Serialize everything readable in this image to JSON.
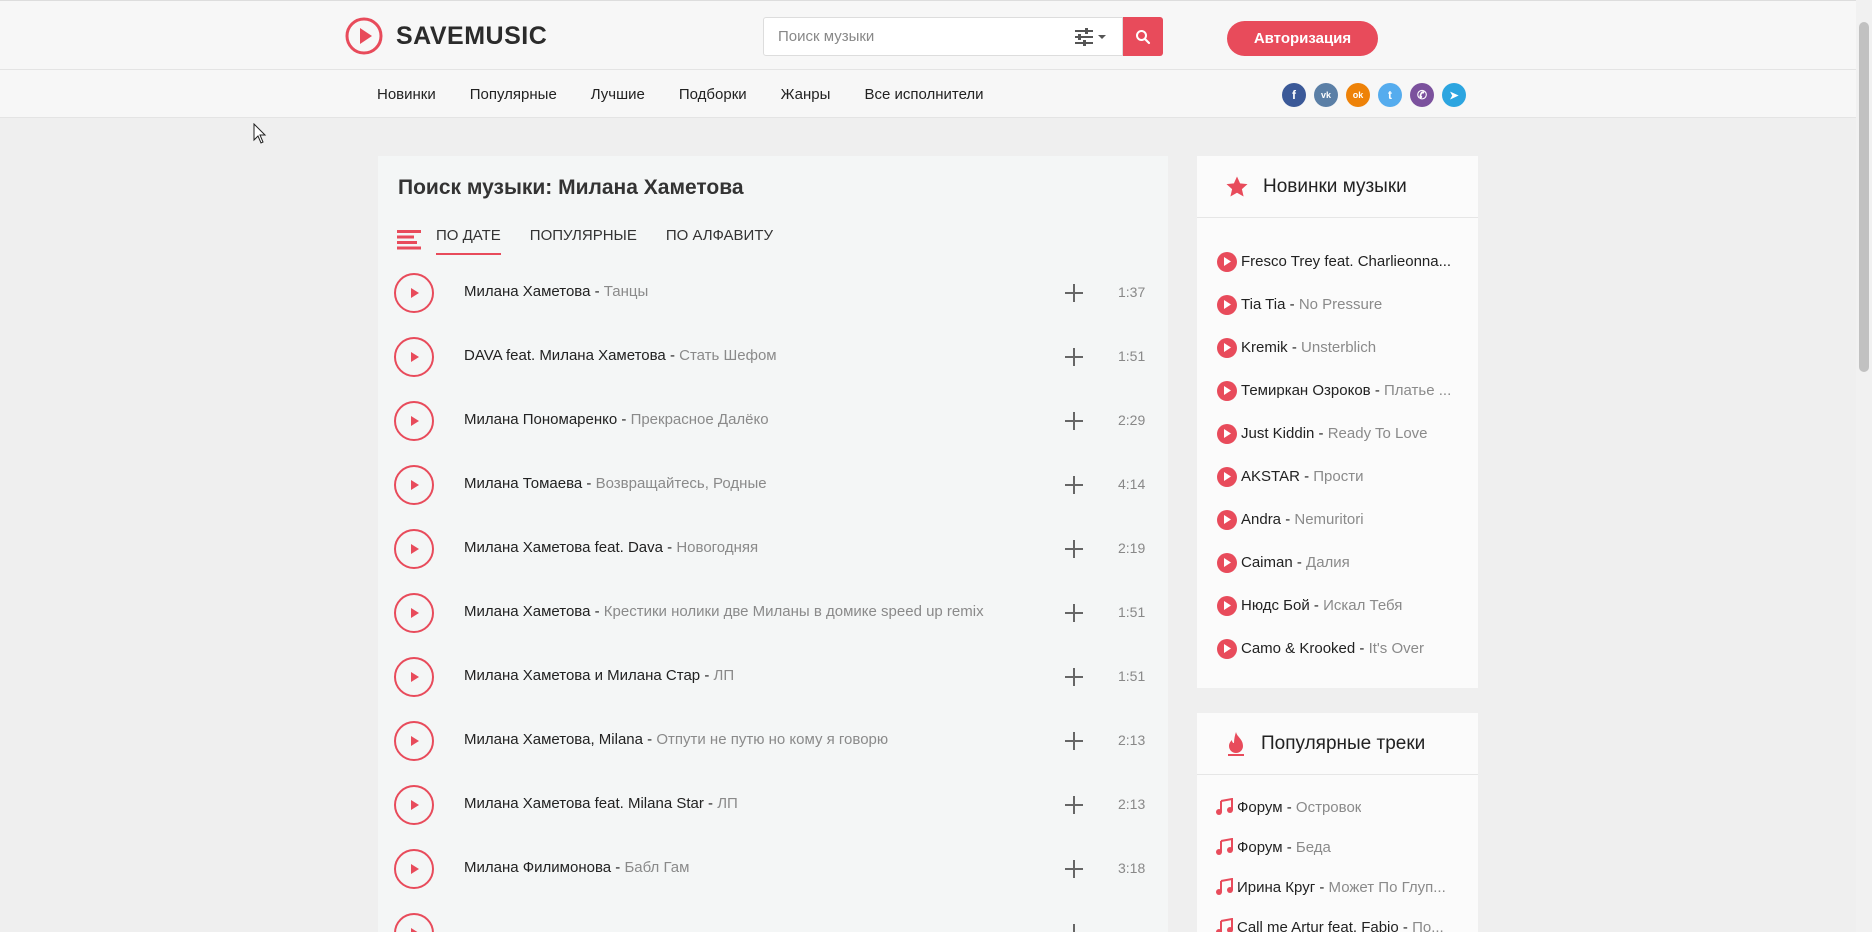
{
  "header": {
    "logo_text": "SAVEMUSIC",
    "search_placeholder": "Поиск музыки",
    "auth_label": "Авторизация",
    "accent_color": "#e84b5b"
  },
  "nav": {
    "items": [
      "Новинки",
      "Популярные",
      "Лучшие",
      "Подборки",
      "Жанры",
      "Все исполнители"
    ]
  },
  "socials": [
    {
      "name": "facebook",
      "glyph": "f",
      "color": "#3b5998"
    },
    {
      "name": "vk",
      "glyph": "vk",
      "color": "#5b7fa6"
    },
    {
      "name": "odnoklassniki",
      "glyph": "ok",
      "color": "#ee8208"
    },
    {
      "name": "twitter",
      "glyph": "t",
      "color": "#55acee"
    },
    {
      "name": "viber",
      "glyph": "✆",
      "color": "#7b519d"
    },
    {
      "name": "telegram",
      "glyph": "➤",
      "color": "#2ca5e0"
    }
  ],
  "main": {
    "title": "Поиск музыки: Милана Хаметова",
    "tabs": [
      "ПО ДАТЕ",
      "ПОПУЛЯРНЫЕ",
      "ПО АЛФАВИТУ"
    ],
    "active_tab": 0,
    "tracks": [
      {
        "artist": "Милана Хаметова",
        "song": "Танцы",
        "duration": "1:37"
      },
      {
        "artist": "DAVA feat. Милана Хаметова",
        "song": "Стать Шефом",
        "duration": "1:51"
      },
      {
        "artist": "Милана Пономаренко",
        "song": "Прекрасное Далёко",
        "duration": "2:29"
      },
      {
        "artist": "Милана Томаева",
        "song": "Возвращайтесь, Родные",
        "duration": "4:14"
      },
      {
        "artist": "Милана Хаметова feat. Dava",
        "song": "Новогодняя",
        "duration": "2:19"
      },
      {
        "artist": "Милана Хаметова",
        "song": "Крестики нолики две Миланы в домике speed up remix",
        "duration": "1:51"
      },
      {
        "artist": "Милана Хаметова и Милана Стар",
        "song": "ЛП",
        "duration": "1:51"
      },
      {
        "artist": "Милана Хаметова, Milana",
        "song": "Отпути не путю но кому я говорю",
        "duration": "2:13"
      },
      {
        "artist": "Милана Хаметова feat. Milana Star",
        "song": "ЛП",
        "duration": "2:13"
      },
      {
        "artist": "Милана Филимонова",
        "song": "Бабл Гам",
        "duration": "3:18"
      },
      {
        "artist": "",
        "song": "",
        "duration": ""
      }
    ]
  },
  "sidebar_new": {
    "title": "Новинки музыки",
    "items": [
      {
        "artist": "Fresco Trey feat. Charlieonna...",
        "song": ""
      },
      {
        "artist": "Tia Tia",
        "song": "No Pressure"
      },
      {
        "artist": "Kremik",
        "song": "Unsterblich"
      },
      {
        "artist": "Темиркан Озроков",
        "song": "Платье ..."
      },
      {
        "artist": "Just Kiddin",
        "song": "Ready To Love"
      },
      {
        "artist": "AKSTAR",
        "song": "Прости"
      },
      {
        "artist": "Andra",
        "song": "Nemuritori"
      },
      {
        "artist": "Caiman",
        "song": "Далия"
      },
      {
        "artist": "Нюдс Бой",
        "song": "Искал Тебя"
      },
      {
        "artist": "Camo & Krooked",
        "song": "It's Over"
      }
    ]
  },
  "sidebar_popular": {
    "title": "Популярные треки",
    "items": [
      {
        "artist": "Форум",
        "song": "Островок"
      },
      {
        "artist": "Форум",
        "song": "Беда"
      },
      {
        "artist": "Ирина Круг",
        "song": "Может По Глуп..."
      },
      {
        "artist": "Call me Artur feat. Fabio",
        "song": "По..."
      }
    ]
  }
}
